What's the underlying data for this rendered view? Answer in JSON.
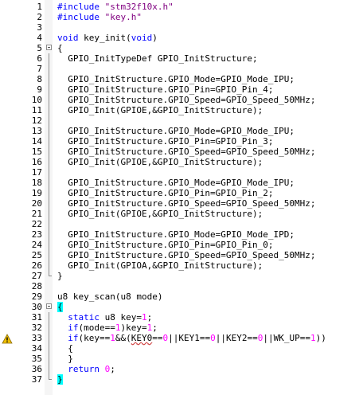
{
  "editor": {
    "lines": [
      {
        "n": "1",
        "seg": [
          {
            "t": "#include ",
            "c": "kw"
          },
          {
            "t": "\"stm32f10x.h\"",
            "c": "str"
          }
        ]
      },
      {
        "n": "2",
        "seg": [
          {
            "t": "#include ",
            "c": "kw"
          },
          {
            "t": "\"key.h\"",
            "c": "str"
          }
        ]
      },
      {
        "n": "3",
        "seg": []
      },
      {
        "n": "4",
        "seg": [
          {
            "t": "void",
            "c": "kw"
          },
          {
            "t": " key_init("
          },
          {
            "t": "void",
            "c": "kw"
          },
          {
            "t": ")"
          }
        ]
      },
      {
        "n": "5",
        "fold": "open",
        "seg": [
          {
            "t": "{"
          }
        ]
      },
      {
        "n": "6",
        "fold": "line",
        "seg": [
          {
            "t": "  GPIO_InitTypeDef GPIO_InitStructure;"
          }
        ]
      },
      {
        "n": "7",
        "fold": "line",
        "seg": []
      },
      {
        "n": "8",
        "fold": "line",
        "seg": [
          {
            "t": "  GPIO_InitStructure.GPIO_Mode=GPIO_Mode_IPU;"
          }
        ]
      },
      {
        "n": "9",
        "fold": "line",
        "seg": [
          {
            "t": "  GPIO_InitStructure.GPIO_Pin=GPIO_Pin_4;"
          }
        ]
      },
      {
        "n": "10",
        "fold": "line",
        "seg": [
          {
            "t": "  GPIO_InitStructure.GPIO_Speed=GPIO_Speed_50MHz;"
          }
        ]
      },
      {
        "n": "11",
        "fold": "line",
        "seg": [
          {
            "t": "  GPIO_Init(GPIOE,&GPIO_InitStructure);"
          }
        ]
      },
      {
        "n": "12",
        "fold": "line",
        "seg": []
      },
      {
        "n": "13",
        "fold": "line",
        "seg": [
          {
            "t": "  GPIO_InitStructure.GPIO_Mode=GPIO_Mode_IPU;"
          }
        ]
      },
      {
        "n": "14",
        "fold": "line",
        "seg": [
          {
            "t": "  GPIO_InitStructure.GPIO_Pin=GPIO_Pin_3;"
          }
        ]
      },
      {
        "n": "15",
        "fold": "line",
        "seg": [
          {
            "t": "  GPIO_InitStructure.GPIO_Speed=GPIO_Speed_50MHz;"
          }
        ]
      },
      {
        "n": "16",
        "fold": "line",
        "seg": [
          {
            "t": "  GPIO_Init(GPIOE,&GPIO_InitStructure);"
          }
        ]
      },
      {
        "n": "17",
        "fold": "line",
        "seg": []
      },
      {
        "n": "18",
        "fold": "line",
        "seg": [
          {
            "t": "  GPIO_InitStructure.GPIO_Mode=GPIO_Mode_IPU;"
          }
        ]
      },
      {
        "n": "19",
        "fold": "line",
        "seg": [
          {
            "t": "  GPIO_InitStructure.GPIO_Pin=GPIO_Pin_2;"
          }
        ]
      },
      {
        "n": "20",
        "fold": "line",
        "seg": [
          {
            "t": "  GPIO_InitStructure.GPIO_Speed=GPIO_Speed_50MHz;"
          }
        ]
      },
      {
        "n": "21",
        "fold": "line",
        "seg": [
          {
            "t": "  GPIO_Init(GPIOE,&GPIO_InitStructure);"
          }
        ]
      },
      {
        "n": "22",
        "fold": "line",
        "seg": []
      },
      {
        "n": "23",
        "fold": "line",
        "seg": [
          {
            "t": "  GPIO_InitStructure.GPIO_Mode=GPIO_Mode_IPD;"
          }
        ]
      },
      {
        "n": "24",
        "fold": "line",
        "seg": [
          {
            "t": "  GPIO_InitStructure.GPIO_Pin=GPIO_Pin_0;"
          }
        ]
      },
      {
        "n": "25",
        "fold": "line",
        "seg": [
          {
            "t": "  GPIO_InitStructure.GPIO_Speed=GPIO_Speed_50MHz;"
          }
        ]
      },
      {
        "n": "26",
        "fold": "line",
        "seg": [
          {
            "t": "  GPIO_Init(GPIOA,&GPIO_InitStructure);"
          }
        ]
      },
      {
        "n": "27",
        "fold": "end",
        "seg": [
          {
            "t": "}"
          }
        ]
      },
      {
        "n": "28",
        "seg": []
      },
      {
        "n": "29",
        "seg": [
          {
            "t": "u8 key_scan(u8 mode)"
          }
        ]
      },
      {
        "n": "30",
        "fold": "open",
        "seg": [
          {
            "t": "{",
            "c": "brace-hl"
          }
        ]
      },
      {
        "n": "31",
        "fold": "line",
        "seg": [
          {
            "t": "  "
          },
          {
            "t": "static",
            "c": "kw"
          },
          {
            "t": " u8 key="
          },
          {
            "t": "1",
            "c": "num"
          },
          {
            "t": ";"
          }
        ]
      },
      {
        "n": "32",
        "fold": "line",
        "seg": [
          {
            "t": "  "
          },
          {
            "t": "if",
            "c": "kw"
          },
          {
            "t": "(mode=="
          },
          {
            "t": "1",
            "c": "num"
          },
          {
            "t": ")key="
          },
          {
            "t": "1",
            "c": "num"
          },
          {
            "t": ";"
          }
        ]
      },
      {
        "n": "33",
        "fold": "line",
        "marker": "warning-icon",
        "seg": [
          {
            "t": "  "
          },
          {
            "t": "if",
            "c": "kw"
          },
          {
            "t": "(key=="
          },
          {
            "t": "1",
            "c": "num"
          },
          {
            "t": "&&("
          },
          {
            "t": "KEY0",
            "c": "squiggle"
          },
          {
            "t": "=="
          },
          {
            "t": "0",
            "c": "num"
          },
          {
            "t": "||KEY1=="
          },
          {
            "t": "0",
            "c": "num"
          },
          {
            "t": "||KEY2=="
          },
          {
            "t": "0",
            "c": "num"
          },
          {
            "t": "||WK_UP=="
          },
          {
            "t": "1",
            "c": "num"
          },
          {
            "t": "))"
          }
        ]
      },
      {
        "n": "34",
        "fold": "line",
        "seg": [
          {
            "t": "  {"
          }
        ]
      },
      {
        "n": "35",
        "fold": "line",
        "seg": [
          {
            "t": "  }"
          }
        ]
      },
      {
        "n": "36",
        "fold": "line",
        "seg": [
          {
            "t": "  "
          },
          {
            "t": "return",
            "c": "kw"
          },
          {
            "t": " "
          },
          {
            "t": "0",
            "c": "num"
          },
          {
            "t": ";"
          }
        ]
      },
      {
        "n": "37",
        "fold": "end",
        "seg": [
          {
            "t": "}",
            "c": "brace-hl"
          }
        ]
      }
    ]
  },
  "colors": {
    "keyword": "#0000ff",
    "string": "#800080",
    "number": "#ff00ff",
    "brace_highlight": "#00ffff",
    "warning": "#f0c000"
  }
}
